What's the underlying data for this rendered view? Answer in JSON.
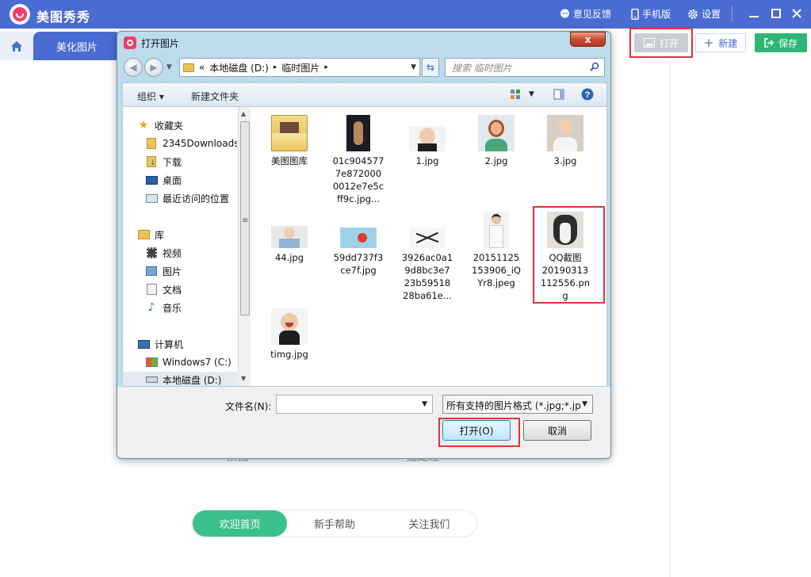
{
  "app": {
    "title": "美图秀秀",
    "feedback": "意见反馈",
    "mobile": "手机版",
    "settings": "设置",
    "tab_beautify": "美化图片",
    "btn_open": "打开",
    "btn_new": "新建",
    "btn_save": "保存",
    "faded_left": "拼图",
    "faded_right": "批处理",
    "bottom_tabs": [
      "欢迎首页",
      "新手帮助",
      "关注我们"
    ],
    "colors": {
      "brand": "#4a6bd2",
      "save": "#2db776",
      "active_tab": "#3cc08b",
      "highlight": "#e0333f"
    }
  },
  "dialog": {
    "title": "打开图片",
    "close_label": "x",
    "path": [
      "«",
      "本地磁盘 (D:)",
      "▸",
      "临时图片",
      "▸"
    ],
    "search_placeholder": "搜索 临时图片",
    "toolbar": {
      "organize": "组织 ▾",
      "new_folder": "新建文件夹"
    },
    "nav": {
      "favorites": "收藏夹",
      "downloads_2345": "2345Downloads",
      "downloads": "下载",
      "desktop": "桌面",
      "recent": "最近访问的位置",
      "libraries": "库",
      "videos": "视频",
      "pictures": "图片",
      "documents": "文档",
      "music": "音乐",
      "computer": "计算机",
      "drive_c": "Windows7 (C:)",
      "drive_d": "本地磁盘 (D:)"
    },
    "files": [
      {
        "name": "美图图库",
        "kind": "folder-icon"
      },
      {
        "name": "01c9045777e8720000012e7e5cff9c.jpg...",
        "lines": [
          "01c904577",
          "7e872000",
          "0012e7e5c",
          "ff9c.jpg..."
        ],
        "kind": "dark-photo"
      },
      {
        "name": "1.jpg",
        "kind": "baby-photo"
      },
      {
        "name": "2.jpg",
        "kind": "cartoon-photo"
      },
      {
        "name": "3.jpg",
        "kind": "child-photo"
      },
      {
        "name": "44.jpg",
        "kind": "baby-photo-2"
      },
      {
        "name": "59dd737f3ce7f.jpg",
        "lines": [
          "59dd737f3",
          "ce7f.jpg"
        ],
        "kind": "blue-photo"
      },
      {
        "name": "3926ac0a19d8bc3e723b5951828ba61e...",
        "lines": [
          "3926ac0a1",
          "9d8bc3e7",
          "23b59518",
          "28ba61e..."
        ],
        "kind": "sparkle-photo"
      },
      {
        "name": "20151125153906_iQYr8.jpeg",
        "lines": [
          "20151125",
          "153906_iQ",
          "Yr8.jpeg"
        ],
        "kind": "man-photo"
      },
      {
        "name": "QQ截图20190313112556.png",
        "lines": [
          "QQ截图",
          "20190313",
          "112556.pn",
          "g"
        ],
        "kind": "dog-photo"
      },
      {
        "name": "timg.jpg",
        "kind": "baby-laugh-photo"
      }
    ],
    "filename_label": "文件名(N):",
    "filename_value": "",
    "filter": "所有支持的图片格式 (*.jpg;*.jp",
    "open_button": "打开(O)",
    "cancel_button": "取消"
  }
}
